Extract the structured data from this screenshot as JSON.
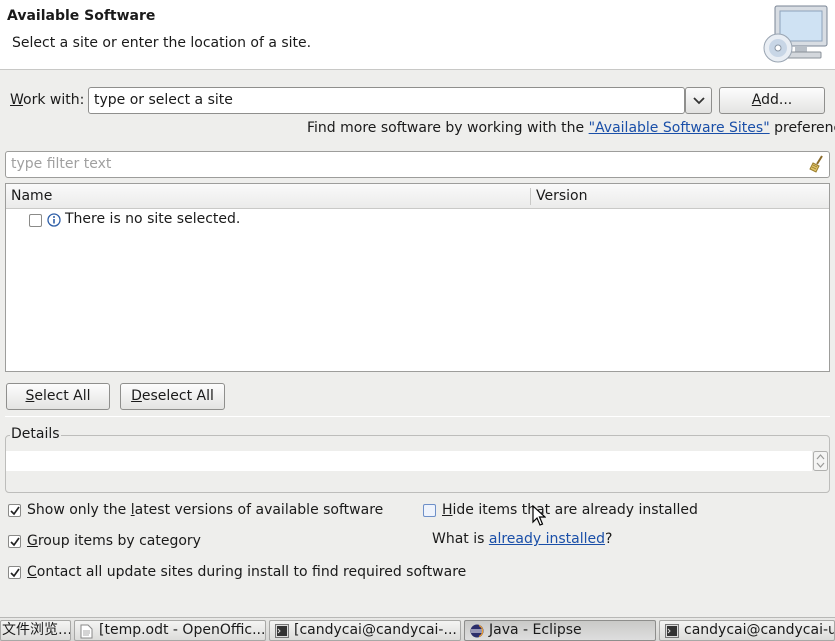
{
  "banner": {
    "title": "Available Software",
    "subtitle": "Select a site or enter the location of a site."
  },
  "work_with": {
    "label_accel": "W",
    "label_rest": "ork with:",
    "value": "type or select a site",
    "add_accel": "A",
    "add_rest": "dd..."
  },
  "find_more": {
    "prefix": "Find more software by working with the ",
    "link": "\"Available Software Sites\"",
    "suffix": " preferences."
  },
  "filter": {
    "placeholder": "type filter text"
  },
  "table": {
    "columns": [
      "Name",
      "Version"
    ],
    "empty_message": "There is no site selected."
  },
  "buttons": {
    "select_all_accel": "S",
    "select_all_rest": "elect All",
    "deselect_all_accel": "D",
    "deselect_all_rest": "eselect All"
  },
  "details": {
    "label": "Details"
  },
  "options": {
    "latest_pre": "Show only the ",
    "latest_accel": "l",
    "latest_post": "atest versions of available software",
    "latest_checked": true,
    "group_accel": "G",
    "group_post": "roup items by category",
    "group_checked": true,
    "contact_accel": "C",
    "contact_post": "ontact all update sites during install to find required software",
    "contact_checked": true,
    "hide_accel": "H",
    "hide_post": "ide items that are already installed",
    "hide_checked": false,
    "whatis_prefix": "What is ",
    "whatis_link": "already installed",
    "whatis_suffix": "?"
  },
  "taskbar": {
    "items": [
      "文件浏览…",
      "[temp.odt - OpenOffic...",
      "[candycai@candycai-...",
      "Java - Eclipse",
      "candycai@candycai-u..."
    ]
  },
  "colors": {
    "link": "#1a4fa8",
    "banner_bg": "#ffffff",
    "dialog_bg": "#eeeeec"
  }
}
